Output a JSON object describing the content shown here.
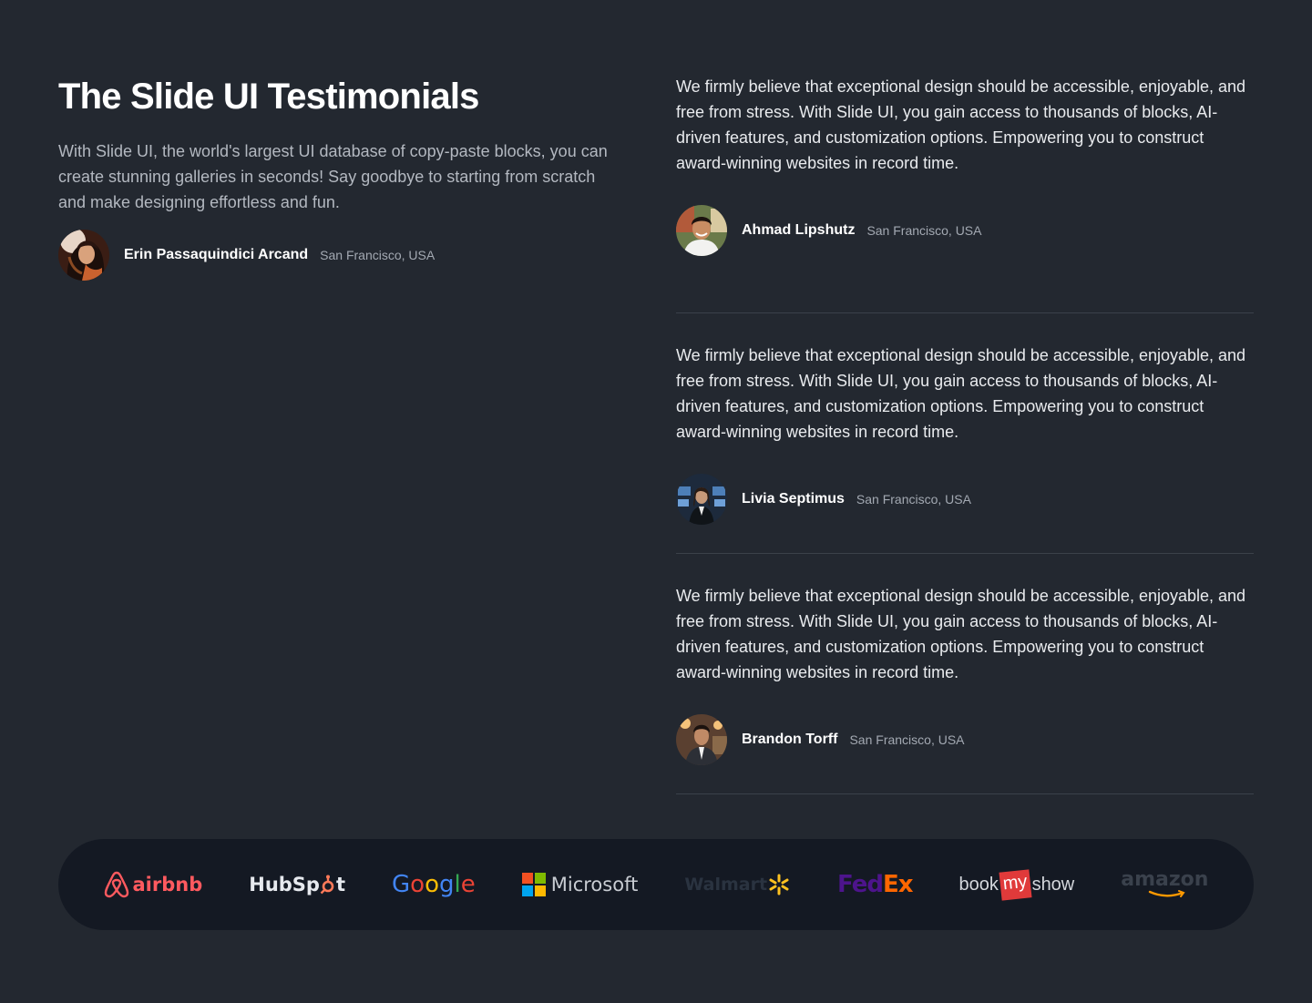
{
  "header": {
    "title": "The Slide UI Testimonials",
    "description": "With Slide UI, the world's largest UI database of copy-paste blocks, you can create stunning galleries in seconds! Say goodbye to starting from scratch and make designing effortless and fun."
  },
  "featured_author": {
    "name": "Erin Passaquindici Arcand",
    "location": "San Francisco, USA",
    "avatar_icon": "avatar-woman-icon"
  },
  "testimonials": [
    {
      "quote": "We firmly believe that exceptional design should be accessible, enjoyable, and free from stress. With Slide UI, you gain access to thousands of blocks, AI-driven features, and customization options. Empowering you to construct award-winning websites in record time.",
      "name": "Ahmad Lipshutz",
      "location": "San Francisco, USA"
    },
    {
      "quote": "We firmly believe that exceptional design should be accessible, enjoyable, and free from stress. With Slide UI, you gain access to thousands of blocks, AI-driven features, and customization options. Empowering you to construct award-winning websites in record time.",
      "name": "Livia Septimus",
      "location": "San Francisco, USA"
    },
    {
      "quote": "We firmly believe that exceptional design should be accessible, enjoyable, and free from stress. With Slide UI, you gain access to thousands of blocks, AI-driven features, and customization options. Empowering you to construct award-winning websites in record time.",
      "name": "Brandon Torff",
      "location": "San Francisco, USA"
    }
  ],
  "logos": {
    "airbnb": "airbnb",
    "hubspot_a": "HubSp",
    "hubspot_b": "t",
    "google": [
      "G",
      "o",
      "o",
      "g",
      "l",
      "e"
    ],
    "microsoft": "Microsoft",
    "walmart": "Walmart",
    "fedex_a": "Fed",
    "fedex_b": "Ex",
    "bookmyshow_a": "book",
    "bookmyshow_b": "my",
    "bookmyshow_c": "show",
    "amazon": "amazon"
  },
  "colors": {
    "background": "#232830",
    "logo_bar": "#141923",
    "divider": "#3b414a",
    "airbnb": "#ff5a5f",
    "fedex_purple": "#4d148c",
    "fedex_orange": "#ff6600",
    "walmart_yellow": "#ffc220"
  }
}
